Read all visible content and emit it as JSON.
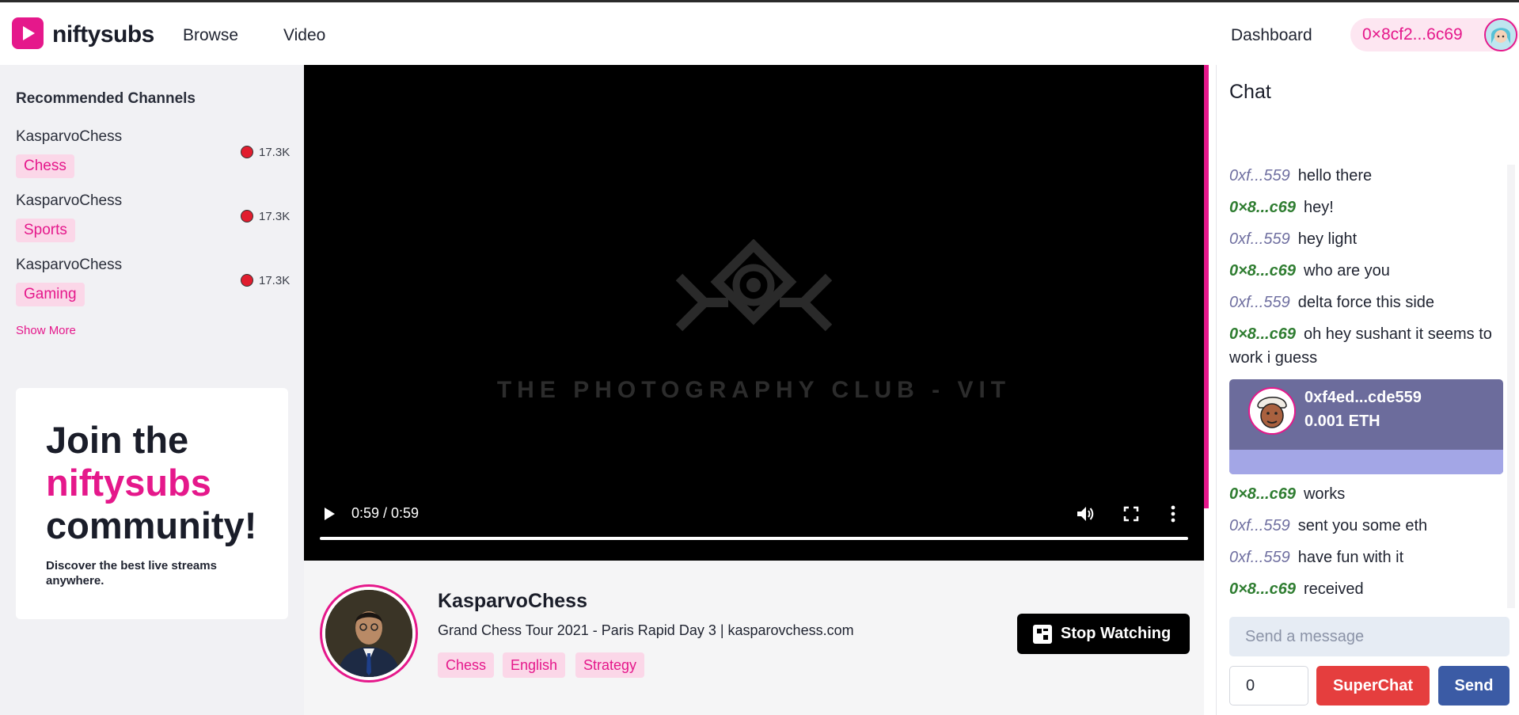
{
  "navbar": {
    "brand": "niftysubs",
    "links": [
      "Browse",
      "Video"
    ],
    "dashboard": "Dashboard",
    "wallet": "0×8cf2...6c69"
  },
  "sidebar": {
    "title": "Recommended Channels",
    "channels": [
      {
        "name": "KasparvoChess",
        "tag": "Chess",
        "viewers": "17.3K"
      },
      {
        "name": "KasparvoChess",
        "tag": "Sports",
        "viewers": "17.3K"
      },
      {
        "name": "KasparvoChess",
        "tag": "Gaming",
        "viewers": "17.3K"
      }
    ],
    "show_more": "Show More",
    "promo": {
      "line1": "Join the",
      "line2": "niftysubs",
      "line3": "community!",
      "subtitle": "Discover the best live streams anywhere."
    }
  },
  "video": {
    "watermark": "THE PHOTOGRAPHY CLUB - VIT",
    "time": "0:59 / 0:59",
    "progress": 1.0
  },
  "stream": {
    "streamer": "KasparvoChess",
    "title": "Grand Chess Tour 2021 - Paris Rapid Day 3 | kasparovchess.com",
    "tags": [
      "Chess",
      "English",
      "Strategy"
    ],
    "stop_label": "Stop Watching"
  },
  "chat": {
    "title": "Chat",
    "messages": [
      {
        "user": "0xf...559",
        "text": "hello there"
      },
      {
        "user": "0×8...c69",
        "text": "hey!"
      },
      {
        "user": "0xf...559",
        "text": "hey light"
      },
      {
        "user": "0×8...c69",
        "text": "who are you"
      },
      {
        "user": "0xf...559",
        "text": "delta force this side"
      },
      {
        "user": "0×8...c69",
        "text": "oh hey sushant it seems to work i guess"
      }
    ],
    "superchat": {
      "user": "0xf4ed...cde559",
      "amount": "0.001 ETH"
    },
    "messages_after": [
      {
        "user": "0×8...c69",
        "text": "works"
      },
      {
        "user": "0xf...559",
        "text": "sent you some eth"
      },
      {
        "user": "0xf...559",
        "text": "have fun with it"
      },
      {
        "user": "0×8...c69",
        "text": "received"
      }
    ],
    "input_placeholder": "Send a message",
    "amount_value": "0",
    "superchat_label": "SuperChat",
    "send_label": "Send"
  },
  "colors": {
    "accent": "#e5188b",
    "user_a": "#6f6fa0",
    "user_b": "#2f7d31",
    "superchat_bg": "#6c6c9c",
    "superchat_btn": "#e53e3e",
    "send_btn": "#3b5ba5"
  }
}
